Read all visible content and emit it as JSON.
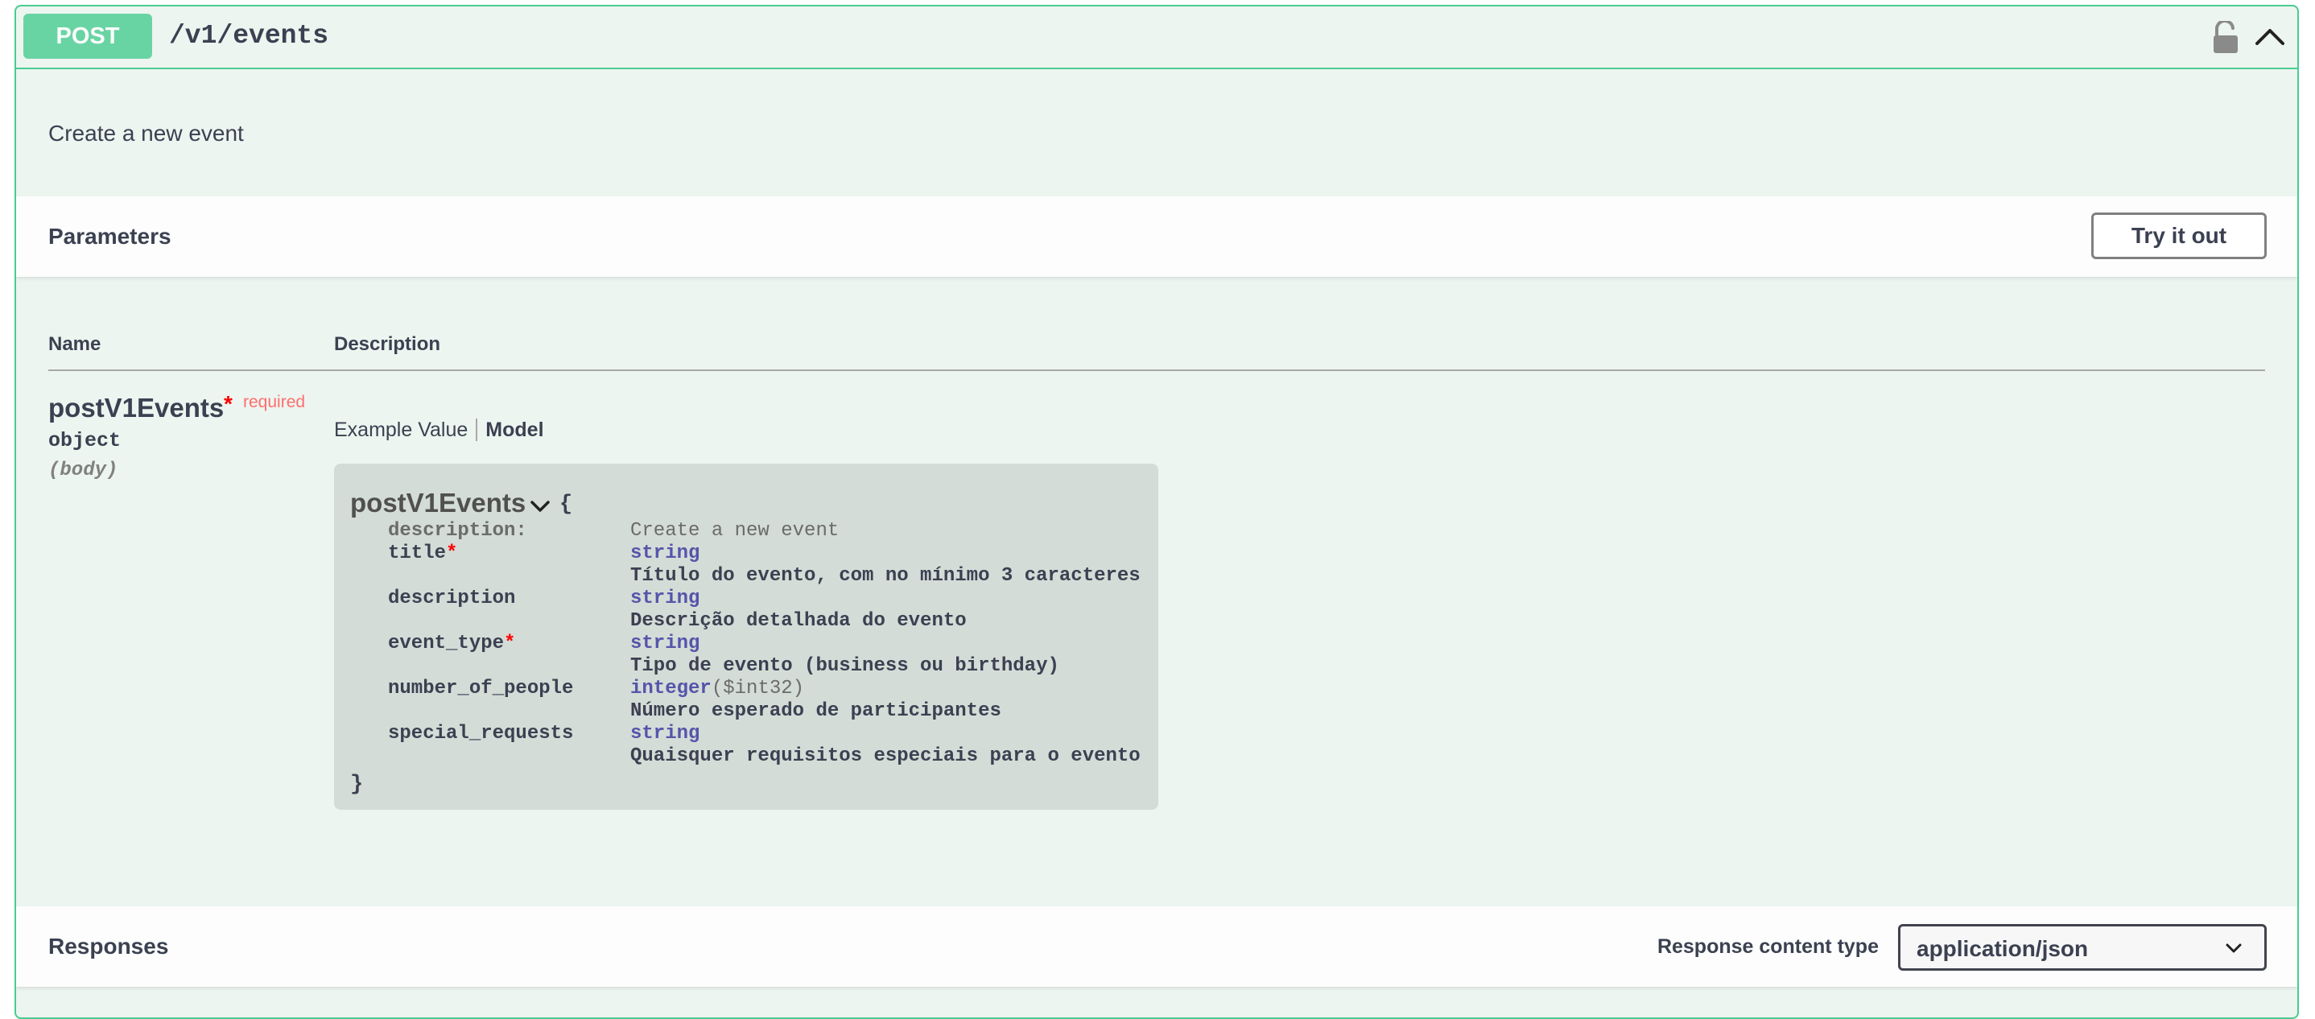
{
  "operation": {
    "method": "POST",
    "path": "/v1/events",
    "summary": "Create a new event",
    "icons": {
      "lock": "lock-icon",
      "collapse": "chevron-up-icon"
    },
    "method_color": "#49cc90"
  },
  "parameters": {
    "title": "Parameters",
    "try_button": "Try it out",
    "columns": {
      "name": "Name",
      "description": "Description"
    },
    "param": {
      "name": "postV1Events",
      "required_star": "*",
      "required_label": "required",
      "type": "object",
      "in": "(body)"
    },
    "tabs": {
      "example": "Example Value",
      "model": "Model"
    },
    "model": {
      "name": "postV1Events",
      "open_brace": "{",
      "close_brace": "}",
      "description_label": "description:",
      "description_value": "Create a new event",
      "properties": [
        {
          "name": "title",
          "required": "*",
          "type": "string",
          "format": "",
          "desc": "Título do evento, com no mínimo 3 caracteres"
        },
        {
          "name": "description",
          "required": "",
          "type": "string",
          "format": "",
          "desc": "Descrição detalhada do evento"
        },
        {
          "name": "event_type",
          "required": "*",
          "type": "string",
          "format": "",
          "desc": "Tipo de evento (business ou birthday)"
        },
        {
          "name": "number_of_people",
          "required": "",
          "type": "integer",
          "format": "($int32)",
          "desc": "Número esperado de participantes"
        },
        {
          "name": "special_requests",
          "required": "",
          "type": "string",
          "format": "",
          "desc": "Quaisquer requisitos especiais para o evento"
        }
      ]
    }
  },
  "responses": {
    "title": "Responses",
    "content_type_label": "Response content type",
    "content_type_value": "application/json"
  }
}
